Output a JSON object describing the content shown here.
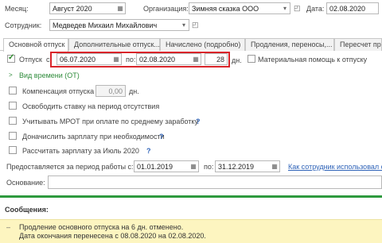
{
  "header": {
    "month_label": "Месяц:",
    "month_value": "Август 2020",
    "org_label": "Организация:",
    "org_value": "Зимняя сказка ООО",
    "date_label": "Дата:",
    "date_value": "02.08.2020",
    "employee_label": "Сотрудник:",
    "employee_value": "Медведев Михаил Михайлович"
  },
  "tabs": [
    {
      "label": "Основной отпуск"
    },
    {
      "label": "Дополнительные отпуск..."
    },
    {
      "label": "Начислено (подробно)"
    },
    {
      "label": "Продления, переносы,..."
    },
    {
      "label": "Пересчет пр"
    }
  ],
  "vacation": {
    "label": "Отпуск",
    "from_label": "с:",
    "from_value": "06.07.2020",
    "to_label": "по:",
    "to_value": "02.08.2020",
    "days_value": "28",
    "days_unit": "дн.",
    "material_help_label": "Материальная помощь к отпуску"
  },
  "time_type_link": "Вид времени (ОТ)",
  "compensation": {
    "label": "Компенсация отпуска",
    "value": "0,00",
    "unit": "дн."
  },
  "options": [
    {
      "label": "Освободить ставку на период отсутствия",
      "q": ""
    },
    {
      "label": "Учитывать МРОТ при оплате по среднему заработку",
      "q": "?"
    },
    {
      "label": "Доначислить зарплату при необходимости",
      "q": "?"
    },
    {
      "label": "Рассчитать зарплату за Июль 2020",
      "q": "?"
    }
  ],
  "work_period": {
    "label": "Предоставляется за период работы с:",
    "from_value": "01.01.2019",
    "to_label": "по:",
    "to_value": "31.12.2019",
    "link": "Как сотрудник использовал отп"
  },
  "basis_label": "Основание:",
  "messages": {
    "title": "Сообщения:",
    "line1": "Продление основного отпуска на 6 дн. отменено.",
    "line2": "Дата окончания перенесена с 08.08.2020 на 02.08.2020."
  }
}
